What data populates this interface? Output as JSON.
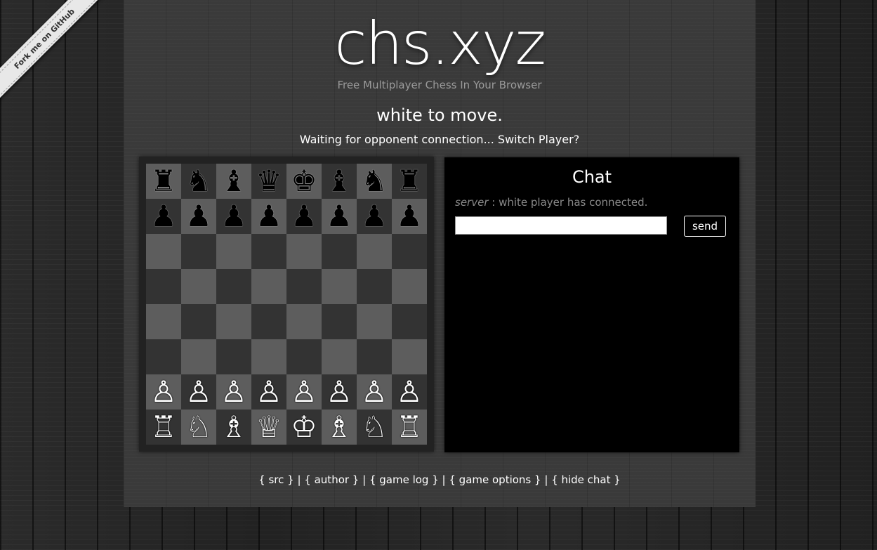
{
  "ribbon": {
    "label": "Fork me on GitHub"
  },
  "header": {
    "logo": "chs.xyz",
    "tagline": "Free Multiplayer Chess In Your Browser"
  },
  "game": {
    "turn_text": "white to move.",
    "status_text": "Waiting for opponent connection...",
    "switch_player_label": "Switch Player?"
  },
  "board": {
    "light_color": "#5d5d5d",
    "dark_color": "#333333",
    "rows": [
      [
        "♜",
        "♞",
        "♝",
        "♛",
        "♚",
        "♝",
        "♞",
        "♜"
      ],
      [
        "♟",
        "♟",
        "♟",
        "♟",
        "♟",
        "♟",
        "♟",
        "♟"
      ],
      [
        "",
        "",
        "",
        "",
        "",
        "",
        "",
        ""
      ],
      [
        "",
        "",
        "",
        "",
        "",
        "",
        "",
        ""
      ],
      [
        "",
        "",
        "",
        "",
        "",
        "",
        "",
        ""
      ],
      [
        "",
        "",
        "",
        "",
        "",
        "",
        "",
        ""
      ],
      [
        "♙",
        "♙",
        "♙",
        "♙",
        "♙",
        "♙",
        "♙",
        "♙"
      ],
      [
        "♖",
        "♘",
        "♗",
        "♕",
        "♔",
        "♗",
        "♘",
        "♖"
      ]
    ],
    "colors": [
      [
        "black",
        "black",
        "black",
        "black",
        "black",
        "black",
        "black",
        "black"
      ],
      [
        "black",
        "black",
        "black",
        "black",
        "black",
        "black",
        "black",
        "black"
      ],
      [
        "",
        "",
        "",
        "",
        "",
        "",
        "",
        ""
      ],
      [
        "",
        "",
        "",
        "",
        "",
        "",
        "",
        ""
      ],
      [
        "",
        "",
        "",
        "",
        "",
        "",
        "",
        ""
      ],
      [
        "",
        "",
        "",
        "",
        "",
        "",
        "",
        ""
      ],
      [
        "white",
        "white",
        "white",
        "white",
        "white",
        "white",
        "white",
        "white"
      ],
      [
        "white",
        "white",
        "white",
        "white",
        "white",
        "white",
        "white",
        "white"
      ]
    ]
  },
  "chat": {
    "title": "Chat",
    "messages": [
      {
        "sender": "server",
        "separator": " : ",
        "text": "white player has connected."
      }
    ],
    "input_value": "",
    "send_label": "send"
  },
  "footer": {
    "links": [
      {
        "label": "{ src }"
      },
      {
        "label": "{ author }"
      },
      {
        "label": "{ game log }"
      },
      {
        "label": "{ game options }"
      },
      {
        "label": "{ hide chat }"
      }
    ],
    "separator": " | "
  }
}
